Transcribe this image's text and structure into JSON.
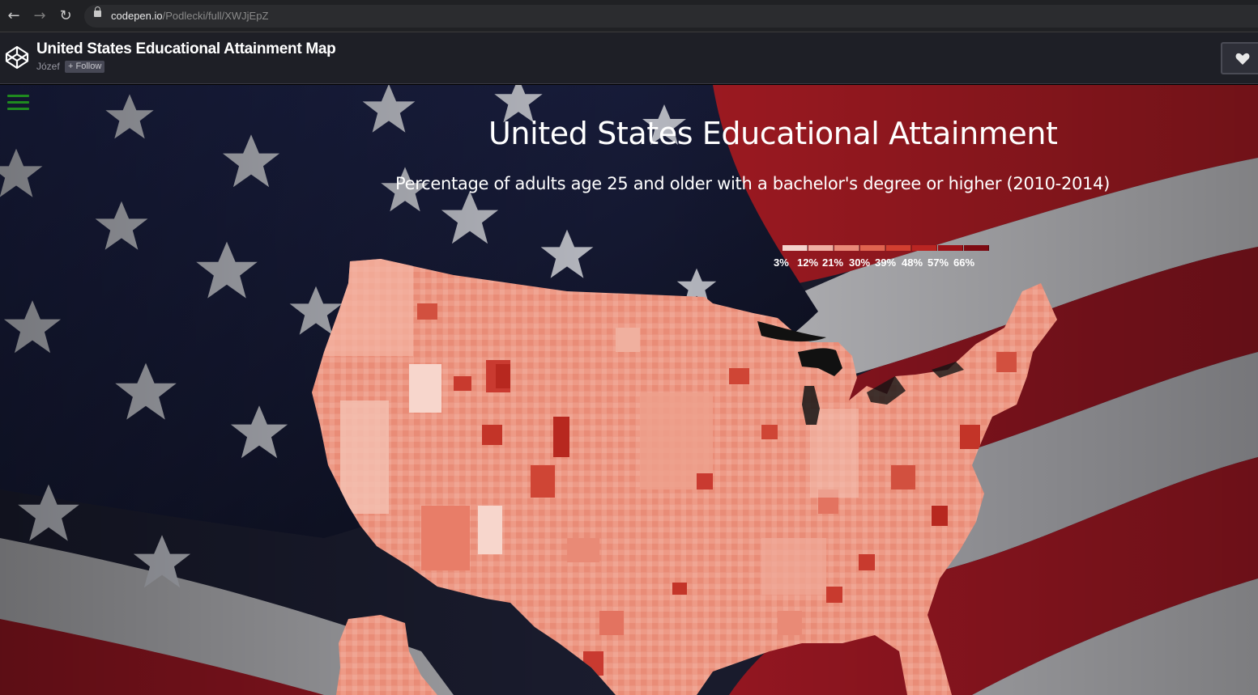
{
  "browser": {
    "url_domain": "codepen.io",
    "url_path": "/Podlecki/full/XWJjEpZ"
  },
  "codepen": {
    "title": "United States Educational Attainment Map",
    "author": "Józef",
    "follow_label": "+ Follow"
  },
  "visualization": {
    "title": "United States Educational Attainment",
    "subtitle": "Percentage of adults age 25 and older with a bachelor's degree or higher (2010-2014)",
    "legend": {
      "labels": [
        "3%",
        "12%",
        "21%",
        "30%",
        "39%",
        "48%",
        "57%",
        "66%"
      ],
      "colors": [
        "#f4d3cd",
        "#f0aea2",
        "#e98978",
        "#e0634f",
        "#d23f30",
        "#b92522",
        "#9c1219",
        "#7d0a12"
      ]
    }
  },
  "colors": {
    "flag_blue": "#1a1f3d",
    "flag_red": "#9e1a26",
    "flag_white": "#b8b8bc",
    "map_base": "#ee9a86"
  }
}
